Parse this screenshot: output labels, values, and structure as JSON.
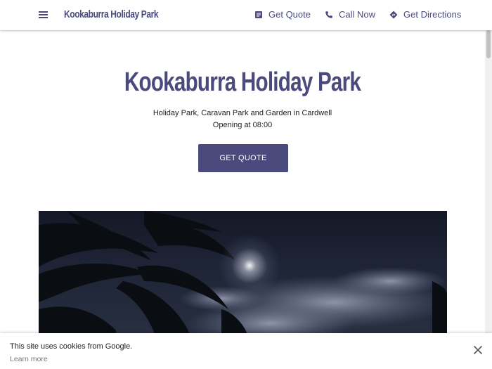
{
  "header": {
    "brand": "Kookaburra Holiday Park",
    "nav": [
      {
        "label": "Get Quote",
        "icon": "quote-icon"
      },
      {
        "label": "Call Now",
        "icon": "phone-icon"
      },
      {
        "label": "Get Directions",
        "icon": "directions-icon"
      }
    ],
    "menu_icon": "menu-icon"
  },
  "hero": {
    "title": "Kookaburra Holiday Park",
    "subtitle": "Holiday Park, Caravan Park and Garden in Cardwell",
    "hours": "Opening at 08:00",
    "cta_label": "GET QUOTE"
  },
  "cookie_banner": {
    "text": "This site uses cookies from Google.",
    "link": "Learn more",
    "close_icon": "close-icon"
  },
  "colors": {
    "brand": "#4a4a7c",
    "background": "#ffffff"
  }
}
